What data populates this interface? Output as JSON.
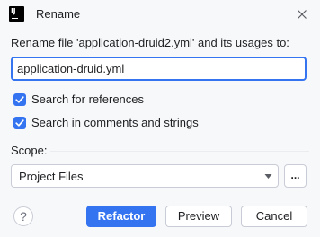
{
  "dialog": {
    "title": "Rename",
    "app_icon": "intellij-idea-icon",
    "close_icon": "close-icon",
    "accent_color": "#3574f0"
  },
  "rename": {
    "label": "Rename file 'application-druid2.yml' and its usages to:",
    "new_name_value": "application-druid.yml"
  },
  "options": {
    "search_references": {
      "label": "Search for references",
      "checked": true
    },
    "search_comments": {
      "label": "Search in comments and strings",
      "checked": true
    }
  },
  "scope": {
    "label": "Scope:",
    "selected": "Project Files",
    "browse_label": "..."
  },
  "buttons": {
    "help": "?",
    "refactor": "Refactor",
    "preview": "Preview",
    "cancel": "Cancel"
  }
}
